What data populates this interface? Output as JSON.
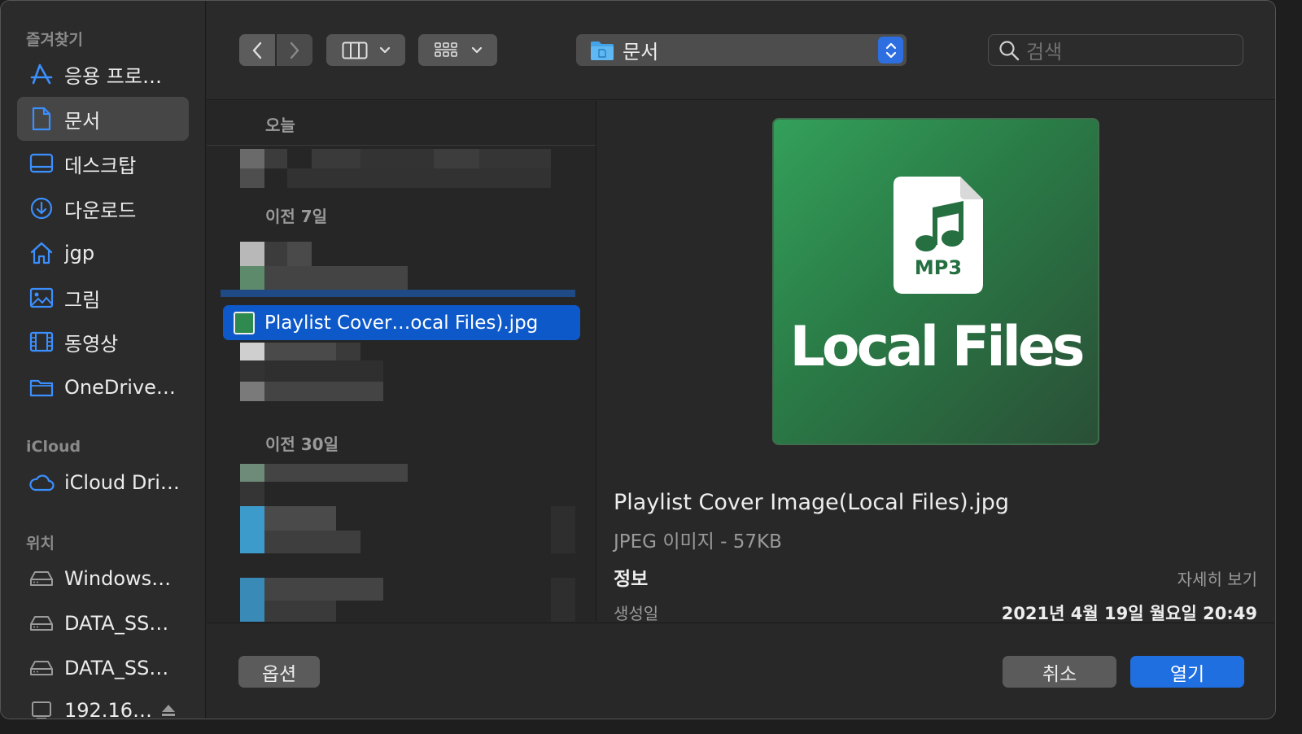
{
  "sidebar": {
    "favorites_heading": "즐겨찾기",
    "favorites": [
      {
        "label": "응용 프로…",
        "icon": "app-store-icon"
      },
      {
        "label": "문서",
        "icon": "document-icon",
        "selected": true
      },
      {
        "label": "데스크탑",
        "icon": "desktop-icon"
      },
      {
        "label": "다운로드",
        "icon": "download-icon"
      },
      {
        "label": "jgp",
        "icon": "home-icon"
      },
      {
        "label": "그림",
        "icon": "picture-icon"
      },
      {
        "label": "동영상",
        "icon": "film-icon"
      },
      {
        "label": "OneDrive…",
        "icon": "folder-icon"
      }
    ],
    "icloud_heading": "iCloud",
    "icloud": [
      {
        "label": "iCloud Dri…",
        "icon": "cloud-icon"
      }
    ],
    "locations_heading": "위치",
    "locations": [
      {
        "label": "Windows…",
        "icon": "drive-icon"
      },
      {
        "label": "DATA_SS…",
        "icon": "drive-icon"
      },
      {
        "label": "DATA_SS…",
        "icon": "drive-icon"
      },
      {
        "label": "192.16…",
        "icon": "network-icon"
      }
    ]
  },
  "toolbar": {
    "path": "문서",
    "search_placeholder": "검색"
  },
  "list": {
    "groups": [
      "오늘",
      "이전 7일",
      "이전 30일"
    ],
    "selected_file": "Playlist Cover…ocal Files).jpg"
  },
  "preview": {
    "cover_badge": "MP3",
    "cover_title": "Local Files",
    "file_name": "Playlist Cover Image(Local Files).jpg",
    "kind": "JPEG 이미지 - 57KB",
    "info_heading": "정보",
    "show_more": "자세히 보기",
    "created_label": "생성일",
    "created_value": "2021년 4월 19일 월요일 20:49"
  },
  "buttons": {
    "options": "옵션",
    "cancel": "취소",
    "open": "열기"
  },
  "colors": {
    "accent": "#1f6fe0",
    "selection": "#0d59c9",
    "cover_green": "#2e8a4f"
  }
}
